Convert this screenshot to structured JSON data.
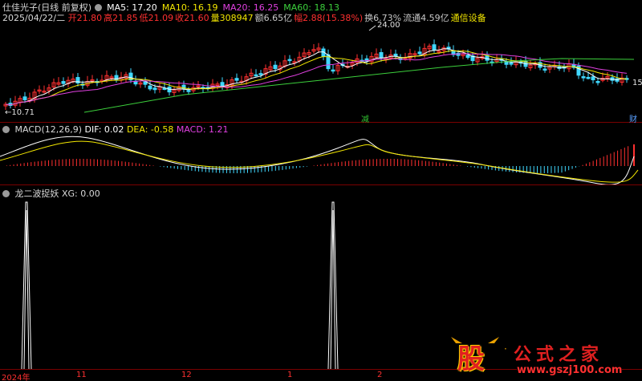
{
  "header": {
    "stock_name": "仕佳光子",
    "period": "(日线 前复权)",
    "ma_labels": [
      {
        "text": "MA5: 17.20",
        "color": "#ffffff"
      },
      {
        "text": "MA10: 16.19",
        "color": "#f2e600"
      },
      {
        "text": "MA20: 16.25",
        "color": "#e040e0"
      },
      {
        "text": "MA60: 18.13",
        "color": "#3cd03c"
      }
    ],
    "date": "2025/04/22/二",
    "quote_items": [
      {
        "text": "开21.80",
        "color": "#ff3030"
      },
      {
        "text": "高21.85",
        "color": "#ff3030"
      },
      {
        "text": "低21.09",
        "color": "#ff3030"
      },
      {
        "text": "收21.60",
        "color": "#ff3030"
      },
      {
        "text": "量308947",
        "color": "#f2e600"
      },
      {
        "text": "额6.65亿",
        "color": "#c8c8c8"
      },
      {
        "text": "幅2.88(15.38%)",
        "color": "#ff3030"
      },
      {
        "text": "换6.73%",
        "color": "#c8c8c8"
      },
      {
        "text": "流通4.59亿",
        "color": "#c8c8c8"
      },
      {
        "text": "通信设备",
        "color": "#f2e600"
      }
    ]
  },
  "price_chart": {
    "high_marker": "24.00",
    "low_marker": "10.71",
    "right_value": "15",
    "event_tags": [
      {
        "text": "减",
        "color": "#30c030"
      },
      {
        "text": "财",
        "color": "#5aa0ff"
      }
    ],
    "colors": {
      "up": "#ff3030",
      "down": "#40d8ff",
      "ma5": "#ffffff",
      "ma10": "#f2e600",
      "ma20": "#e040e0",
      "ma60": "#3cd03c"
    }
  },
  "macd_panel": {
    "title": "MACD(12,26,9)",
    "dif": "DIF: 0.02",
    "dea": "DEA: -0.58",
    "macd": "MACD: 1.21"
  },
  "indicator_panel": {
    "title": "龙二波捉妖",
    "xg": "XG: 0.00"
  },
  "x_axis": {
    "labels": [
      "2024年",
      "11",
      "12",
      "1",
      "2"
    ]
  },
  "watermark": {
    "logo_char": "股",
    "brand": "公式之家",
    "url": "www.gszj100.com"
  }
}
